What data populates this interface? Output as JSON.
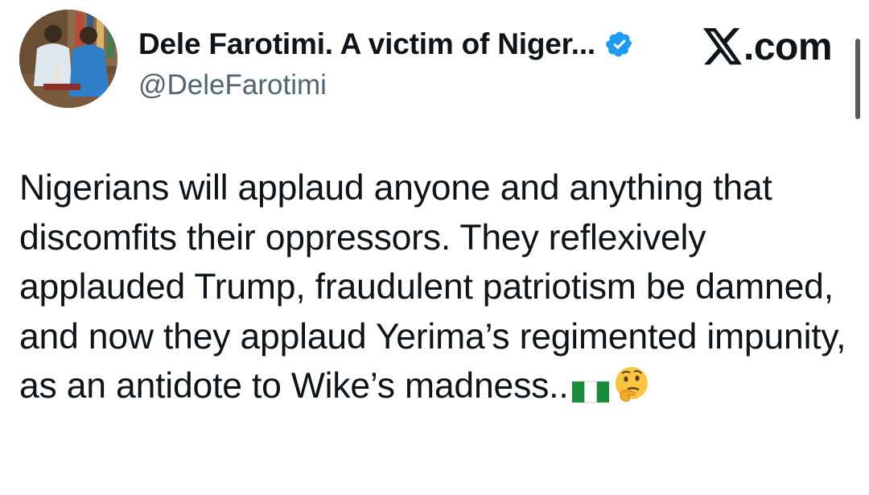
{
  "tweet": {
    "author": {
      "display_name": "Dele Farotimi. A victim of Niger...",
      "handle": "@DeleFarotimi",
      "verified_icon": "verified-badge-icon",
      "verified_color": "#1d9bf0",
      "avatar_icon": "profile-avatar"
    },
    "brand": {
      "logo_icon": "x-logo-icon",
      "domain": ".com"
    },
    "text": "Nigerians will applaud anyone and anything that discomfits their oppressors. They reflexively applauded Trump, fraudulent patriotism be damned, and now they applaud Yerima’s regimented impunity, as an antidote to Wike’s madness..",
    "emojis": [
      "nigeria-flag-icon",
      "thinking-face-icon"
    ]
  },
  "colors": {
    "text": "#0f1419",
    "secondary_text": "#536471",
    "background": "#ffffff"
  }
}
